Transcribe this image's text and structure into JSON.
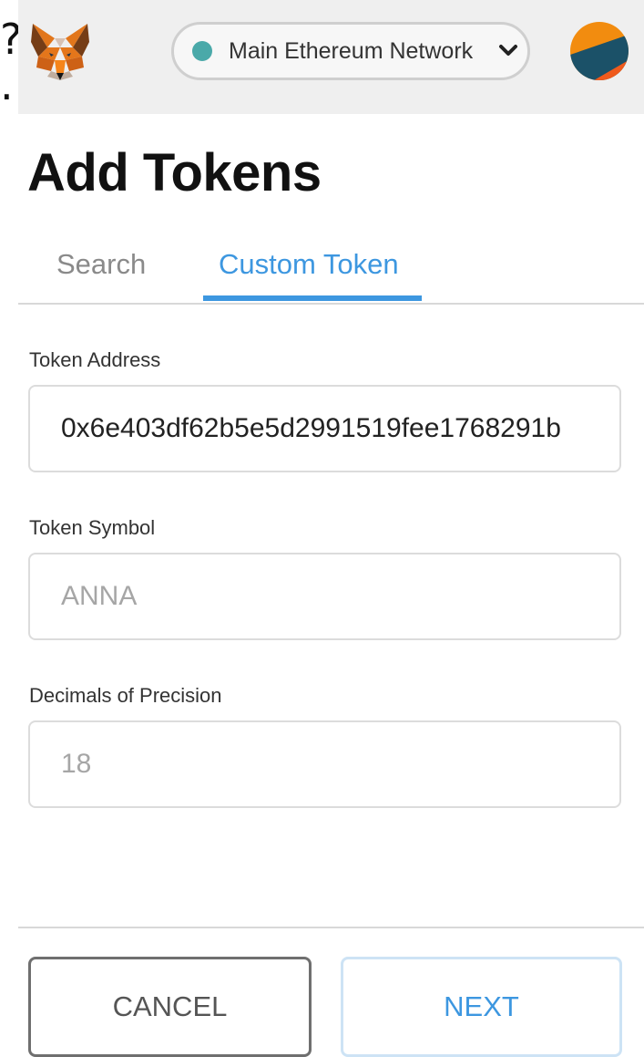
{
  "edge_text": "?\n.",
  "header": {
    "logo_icon": "metamask-fox-icon",
    "network": {
      "label": "Main Ethereum Network",
      "dot_color": "#4aa9a9",
      "dropdown_icon": "chevron-down-icon"
    },
    "avatar_icon": "account-identicon-icon"
  },
  "page": {
    "title": "Add Tokens"
  },
  "tabs": [
    {
      "label": "Search",
      "active": false
    },
    {
      "label": "Custom Token",
      "active": true
    }
  ],
  "form": {
    "token_address": {
      "label": "Token Address",
      "value": "0x6e403df62b5e5d2991519fee1768291b"
    },
    "token_symbol": {
      "label": "Token Symbol",
      "placeholder": "ANNA",
      "value": ""
    },
    "decimals": {
      "label": "Decimals of Precision",
      "placeholder": "18",
      "value": ""
    }
  },
  "footer": {
    "cancel_label": "CANCEL",
    "next_label": "NEXT"
  },
  "colors": {
    "accent": "#3d97e0",
    "header_bg": "#efefef"
  }
}
